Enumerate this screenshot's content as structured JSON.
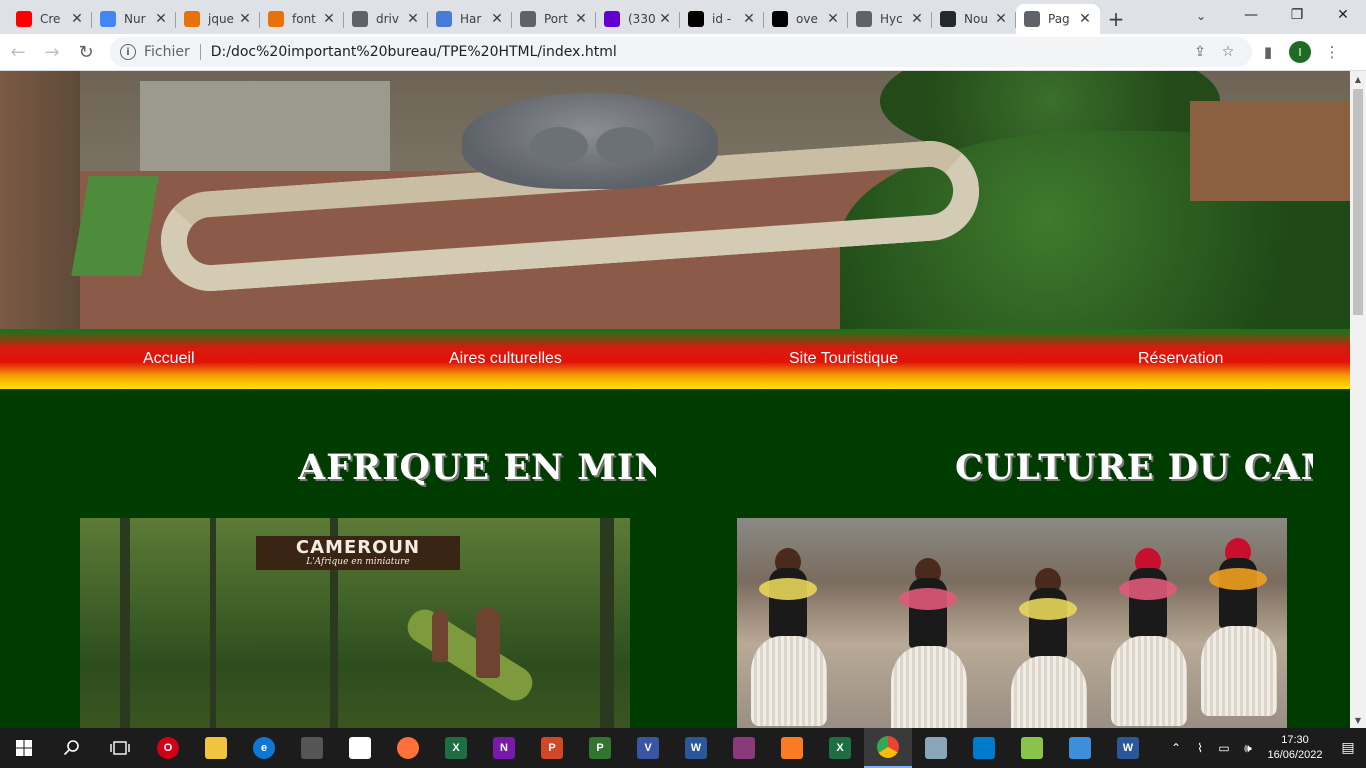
{
  "browser": {
    "tabs": [
      {
        "title": "Cre",
        "icon": "youtube-icon",
        "color": "#ff0000"
      },
      {
        "title": "Nur",
        "icon": "google-apps-icon",
        "color": "#4285f4"
      },
      {
        "title": "jque",
        "icon": "code-icon",
        "color": "#e8710a"
      },
      {
        "title": "font",
        "icon": "code-icon",
        "color": "#e8710a"
      },
      {
        "title": "driv",
        "icon": "drive-icon",
        "color": "#5f6368"
      },
      {
        "title": "Har",
        "icon": "bot-icon",
        "color": "#4a7bd6"
      },
      {
        "title": "Port",
        "icon": "globe-icon",
        "color": "#5f6368"
      },
      {
        "title": "(330",
        "icon": "mail-icon",
        "color": "#6001d2"
      },
      {
        "title": "id -",
        "icon": "medium-icon",
        "color": "#000000"
      },
      {
        "title": "ove",
        "icon": "medium-icon",
        "color": "#000000"
      },
      {
        "title": "Hyc",
        "icon": "globe-icon",
        "color": "#5f6368"
      },
      {
        "title": "Nou",
        "icon": "github-icon",
        "color": "#24292e"
      },
      {
        "title": "Pag",
        "icon": "globe-icon",
        "color": "#5f6368",
        "active": true
      }
    ],
    "new_tab": "+",
    "address": {
      "scheme_label": "Fichier",
      "url": "D:/doc%20important%20bureau/TPE%20HTML/index.html"
    },
    "profile_initial": "I"
  },
  "page": {
    "nav": [
      "Accueil",
      "Aires culturelles",
      "Site Touristique",
      "Réservation"
    ],
    "sections": [
      {
        "title": "AFRIQUE EN MINIATURE",
        "badge_title": "CAMEROUN",
        "badge_sub": "L'Afrique en miniature"
      },
      {
        "title": "CULTURE DU CAMEROUN"
      }
    ]
  },
  "taskbar": {
    "time": "17:30",
    "date": "16/06/2022",
    "apps": [
      {
        "name": "opera",
        "color": "#d00016",
        "glyph": "O"
      },
      {
        "name": "explorer",
        "color": "#f2c43d",
        "glyph": ""
      },
      {
        "name": "edge",
        "color": "#0f78d6",
        "glyph": "e"
      },
      {
        "name": "store",
        "color": "#555555",
        "glyph": ""
      },
      {
        "name": "notepad",
        "color": "#ffffff",
        "glyph": ""
      },
      {
        "name": "firefox",
        "color": "#ff7139",
        "glyph": ""
      },
      {
        "name": "excel",
        "color": "#1d6f42",
        "glyph": "X"
      },
      {
        "name": "onenote",
        "color": "#7719aa",
        "glyph": "N"
      },
      {
        "name": "powerpoint",
        "color": "#d24726",
        "glyph": "P"
      },
      {
        "name": "project",
        "color": "#31752f",
        "glyph": "P"
      },
      {
        "name": "visio",
        "color": "#3955a3",
        "glyph": "V"
      },
      {
        "name": "word",
        "color": "#2b579a",
        "glyph": "W"
      },
      {
        "name": "winrar",
        "color": "#8a3a7a",
        "glyph": ""
      },
      {
        "name": "xampp",
        "color": "#fb7a24",
        "glyph": ""
      },
      {
        "name": "excel-2",
        "color": "#1d6f42",
        "glyph": "X"
      },
      {
        "name": "chrome",
        "color": "#4285f4",
        "glyph": "",
        "active": true
      },
      {
        "name": "scanner",
        "color": "#8aa4b8",
        "glyph": ""
      },
      {
        "name": "vscode",
        "color": "#007acc",
        "glyph": ""
      },
      {
        "name": "notepad-plus",
        "color": "#8bc34a",
        "glyph": ""
      },
      {
        "name": "paint",
        "color": "#3e8ede",
        "glyph": ""
      },
      {
        "name": "word-2",
        "color": "#2b579a",
        "glyph": "W"
      }
    ]
  }
}
